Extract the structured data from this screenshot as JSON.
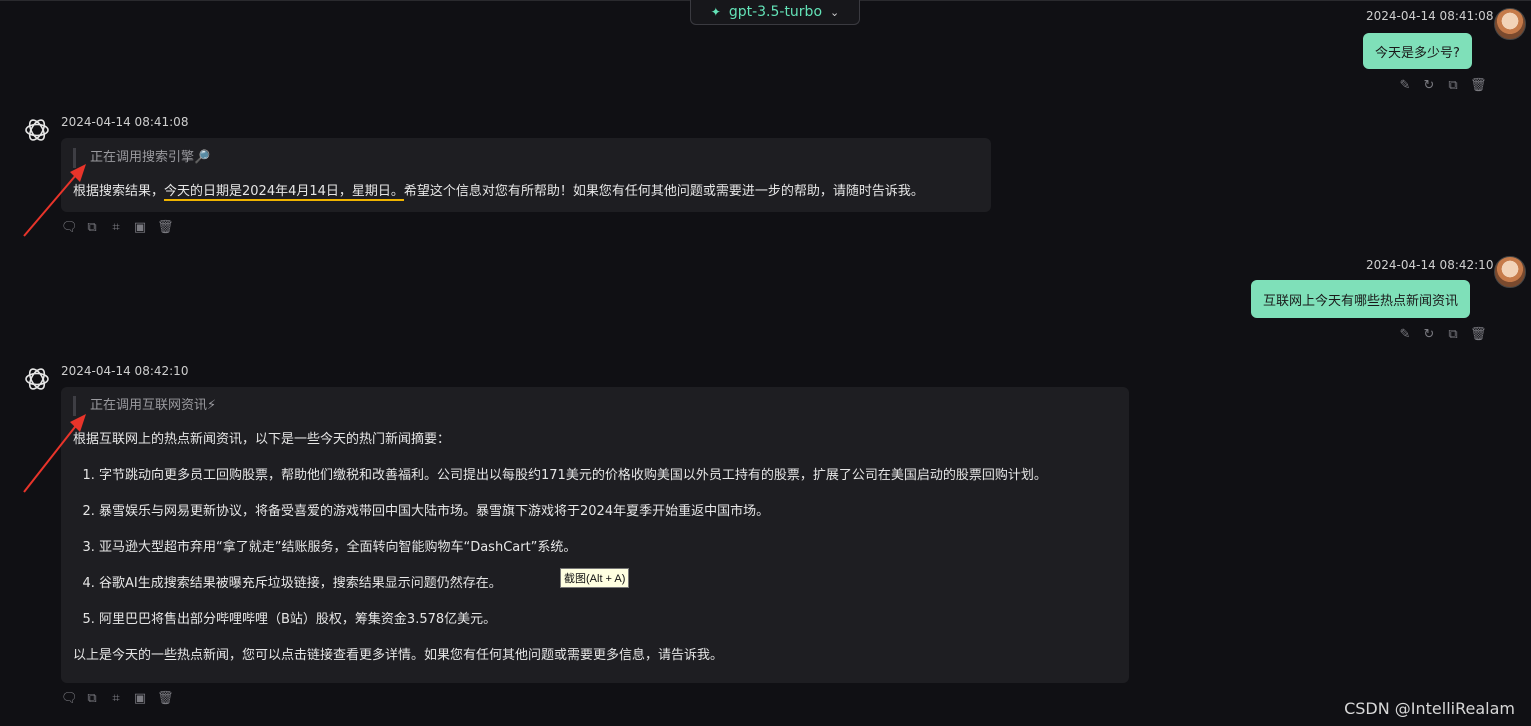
{
  "header": {
    "model": "gpt-3.5-turbo"
  },
  "messages": [
    {
      "role": "user",
      "time": "2024-04-14 08:41:08",
      "text": "今天是多少号?"
    },
    {
      "role": "assistant",
      "time": "2024-04-14 08:41:08",
      "status": "正在调用搜索引擎🔎",
      "pre": "根据搜索结果，",
      "highlight": "今天的日期是2024年4月14日，星期日。",
      "post": "希望这个信息对您有所帮助！如果您有任何其他问题或需要进一步的帮助，请随时告诉我。"
    },
    {
      "role": "user",
      "time": "2024-04-14 08:42:10",
      "text": "互联网上今天有哪些热点新闻资讯"
    },
    {
      "role": "assistant",
      "time": "2024-04-14 08:42:10",
      "status": "正在调用互联网资讯⚡",
      "intro": "根据互联网上的热点新闻资讯，以下是一些今天的热门新闻摘要：",
      "items": [
        "字节跳动向更多员工回购股票，帮助他们缴税和改善福利。公司提出以每股约171美元的价格收购美国以外员工持有的股票，扩展了公司在美国启动的股票回购计划。",
        "暴雪娱乐与网易更新协议，将备受喜爱的游戏带回中国大陆市场。暴雪旗下游戏将于2024年夏季开始重返中国市场。",
        "亚马逊大型超市弃用“拿了就走”结账服务，全面转向智能购物车“DashCart”系统。",
        "谷歌AI生成搜索结果被曝充斥垃圾链接，搜索结果显示问题仍然存在。",
        "阿里巴巴将售出部分哔哩哔哩（B站）股权，筹集资金3.578亿美元。"
      ],
      "outro": "以上是今天的一些热点新闻，您可以点击链接查看更多详情。如果您有任何其他问题或需要更多信息，请告诉我。"
    }
  ],
  "tooltip": "截图(Alt + A)",
  "watermark": "CSDN @IntelliRealam"
}
